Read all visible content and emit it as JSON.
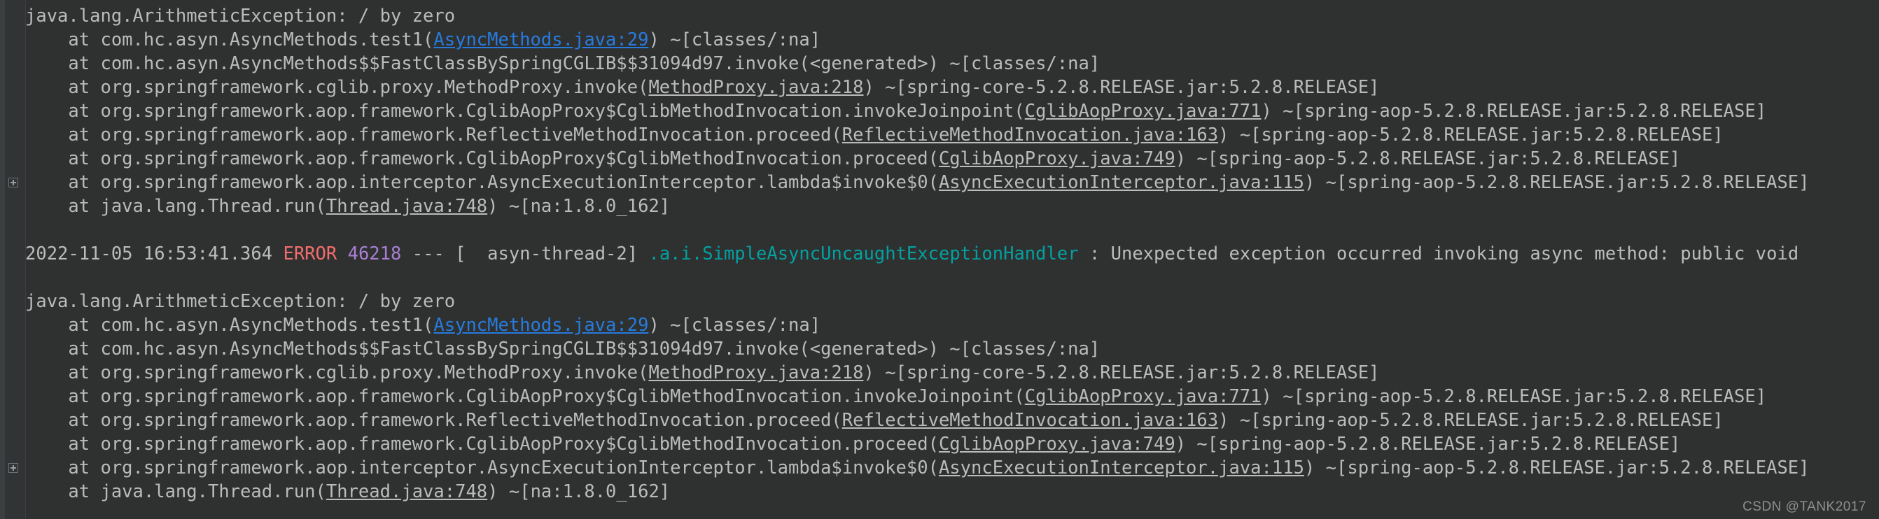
{
  "console": {
    "background_color": "#2f3130",
    "gutter_color": "#313335",
    "text_color": "#bbbbbb",
    "link_color": "#287bde",
    "error_color": "#f26d6d",
    "pid_color": "#a87fd4",
    "logger_color": "#04a0a0",
    "watermark": "CSDN @TANK2017"
  },
  "lines": [
    {
      "id": "l1",
      "fold": false,
      "segments": [
        {
          "kind": "txt",
          "text": "java.lang.ArithmeticException: / by zero"
        }
      ]
    },
    {
      "id": "l2",
      "fold": false,
      "segments": [
        {
          "kind": "txt",
          "text": "    at com.hc.asyn.AsyncMethods.test1("
        },
        {
          "kind": "hotlink",
          "text": "AsyncMethods.java:29"
        },
        {
          "kind": "txt",
          "text": ") ~[classes/:na]"
        }
      ]
    },
    {
      "id": "l3",
      "fold": false,
      "segments": [
        {
          "kind": "txt",
          "text": "    at com.hc.asyn.AsyncMethods$$FastClassBySpringCGLIB$$31094d97.invoke(<generated>) ~[classes/:na]"
        }
      ]
    },
    {
      "id": "l4",
      "fold": false,
      "segments": [
        {
          "kind": "txt",
          "text": "    at org.springframework.cglib.proxy.MethodProxy.invoke("
        },
        {
          "kind": "link",
          "text": "MethodProxy.java:218"
        },
        {
          "kind": "txt",
          "text": ") ~[spring-core-5.2.8.RELEASE.jar:5.2.8.RELEASE]"
        }
      ]
    },
    {
      "id": "l5",
      "fold": false,
      "segments": [
        {
          "kind": "txt",
          "text": "    at org.springframework.aop.framework.CglibAopProxy$CglibMethodInvocation.invokeJoinpoint("
        },
        {
          "kind": "link",
          "text": "CglibAopProxy.java:771"
        },
        {
          "kind": "txt",
          "text": ") ~[spring-aop-5.2.8.RELEASE.jar:5.2.8.RELEASE]"
        }
      ]
    },
    {
      "id": "l6",
      "fold": false,
      "segments": [
        {
          "kind": "txt",
          "text": "    at org.springframework.aop.framework.ReflectiveMethodInvocation.proceed("
        },
        {
          "kind": "link",
          "text": "ReflectiveMethodInvocation.java:163"
        },
        {
          "kind": "txt",
          "text": ") ~[spring-aop-5.2.8.RELEASE.jar:5.2.8.RELEASE]"
        }
      ]
    },
    {
      "id": "l7",
      "fold": false,
      "segments": [
        {
          "kind": "txt",
          "text": "    at org.springframework.aop.framework.CglibAopProxy$CglibMethodInvocation.proceed("
        },
        {
          "kind": "link",
          "text": "CglibAopProxy.java:749"
        },
        {
          "kind": "txt",
          "text": ") ~[spring-aop-5.2.8.RELEASE.jar:5.2.8.RELEASE]"
        }
      ]
    },
    {
      "id": "l8",
      "fold": true,
      "segments": [
        {
          "kind": "txt",
          "text": "    at org.springframework.aop.interceptor.AsyncExecutionInterceptor.lambda$invoke$0("
        },
        {
          "kind": "link",
          "text": "AsyncExecutionInterceptor.java:115"
        },
        {
          "kind": "txt",
          "text": ") ~[spring-aop-5.2.8.RELEASE.jar:5.2.8.RELEASE]"
        }
      ]
    },
    {
      "id": "l9",
      "fold": false,
      "segments": [
        {
          "kind": "txt",
          "text": "    at java.lang.Thread.run("
        },
        {
          "kind": "link",
          "text": "Thread.java:748"
        },
        {
          "kind": "txt",
          "text": ") ~[na:1.8.0_162]"
        }
      ]
    },
    {
      "id": "l10",
      "fold": false,
      "segments": [
        {
          "kind": "txt",
          "text": ""
        }
      ]
    },
    {
      "id": "l11",
      "fold": false,
      "segments": [
        {
          "kind": "txt",
          "text": "2022-11-05 16:53:41.364 "
        },
        {
          "kind": "err",
          "text": "ERROR"
        },
        {
          "kind": "txt",
          "text": " "
        },
        {
          "kind": "pid",
          "text": "46218"
        },
        {
          "kind": "txt",
          "text": " --- [  asyn-thread-2] "
        },
        {
          "kind": "logger",
          "text": ".a.i.SimpleAsyncUncaughtExceptionHandler"
        },
        {
          "kind": "txt",
          "text": " : Unexpected exception occurred invoking async method: public void"
        }
      ]
    },
    {
      "id": "l12",
      "fold": false,
      "segments": [
        {
          "kind": "txt",
          "text": ""
        }
      ]
    },
    {
      "id": "l13",
      "fold": false,
      "segments": [
        {
          "kind": "txt",
          "text": "java.lang.ArithmeticException: / by zero"
        }
      ]
    },
    {
      "id": "l14",
      "fold": false,
      "segments": [
        {
          "kind": "txt",
          "text": "    at com.hc.asyn.AsyncMethods.test1("
        },
        {
          "kind": "hotlink",
          "text": "AsyncMethods.java:29"
        },
        {
          "kind": "txt",
          "text": ") ~[classes/:na]"
        }
      ]
    },
    {
      "id": "l15",
      "fold": false,
      "segments": [
        {
          "kind": "txt",
          "text": "    at com.hc.asyn.AsyncMethods$$FastClassBySpringCGLIB$$31094d97.invoke(<generated>) ~[classes/:na]"
        }
      ]
    },
    {
      "id": "l16",
      "fold": false,
      "segments": [
        {
          "kind": "txt",
          "text": "    at org.springframework.cglib.proxy.MethodProxy.invoke("
        },
        {
          "kind": "link",
          "text": "MethodProxy.java:218"
        },
        {
          "kind": "txt",
          "text": ") ~[spring-core-5.2.8.RELEASE.jar:5.2.8.RELEASE]"
        }
      ]
    },
    {
      "id": "l17",
      "fold": false,
      "segments": [
        {
          "kind": "txt",
          "text": "    at org.springframework.aop.framework.CglibAopProxy$CglibMethodInvocation.invokeJoinpoint("
        },
        {
          "kind": "link",
          "text": "CglibAopProxy.java:771"
        },
        {
          "kind": "txt",
          "text": ") ~[spring-aop-5.2.8.RELEASE.jar:5.2.8.RELEASE]"
        }
      ]
    },
    {
      "id": "l18",
      "fold": false,
      "segments": [
        {
          "kind": "txt",
          "text": "    at org.springframework.aop.framework.ReflectiveMethodInvocation.proceed("
        },
        {
          "kind": "link",
          "text": "ReflectiveMethodInvocation.java:163"
        },
        {
          "kind": "txt",
          "text": ") ~[spring-aop-5.2.8.RELEASE.jar:5.2.8.RELEASE]"
        }
      ]
    },
    {
      "id": "l19",
      "fold": false,
      "segments": [
        {
          "kind": "txt",
          "text": "    at org.springframework.aop.framework.CglibAopProxy$CglibMethodInvocation.proceed("
        },
        {
          "kind": "link",
          "text": "CglibAopProxy.java:749"
        },
        {
          "kind": "txt",
          "text": ") ~[spring-aop-5.2.8.RELEASE.jar:5.2.8.RELEASE]"
        }
      ]
    },
    {
      "id": "l20",
      "fold": true,
      "segments": [
        {
          "kind": "txt",
          "text": "    at org.springframework.aop.interceptor.AsyncExecutionInterceptor.lambda$invoke$0("
        },
        {
          "kind": "link",
          "text": "AsyncExecutionInterceptor.java:115"
        },
        {
          "kind": "txt",
          "text": ") ~[spring-aop-5.2.8.RELEASE.jar:5.2.8.RELEASE]"
        }
      ]
    },
    {
      "id": "l21",
      "fold": false,
      "segments": [
        {
          "kind": "txt",
          "text": "    at java.lang.Thread.run("
        },
        {
          "kind": "link",
          "text": "Thread.java:748"
        },
        {
          "kind": "txt",
          "text": ") ~[na:1.8.0_162]"
        }
      ]
    }
  ]
}
